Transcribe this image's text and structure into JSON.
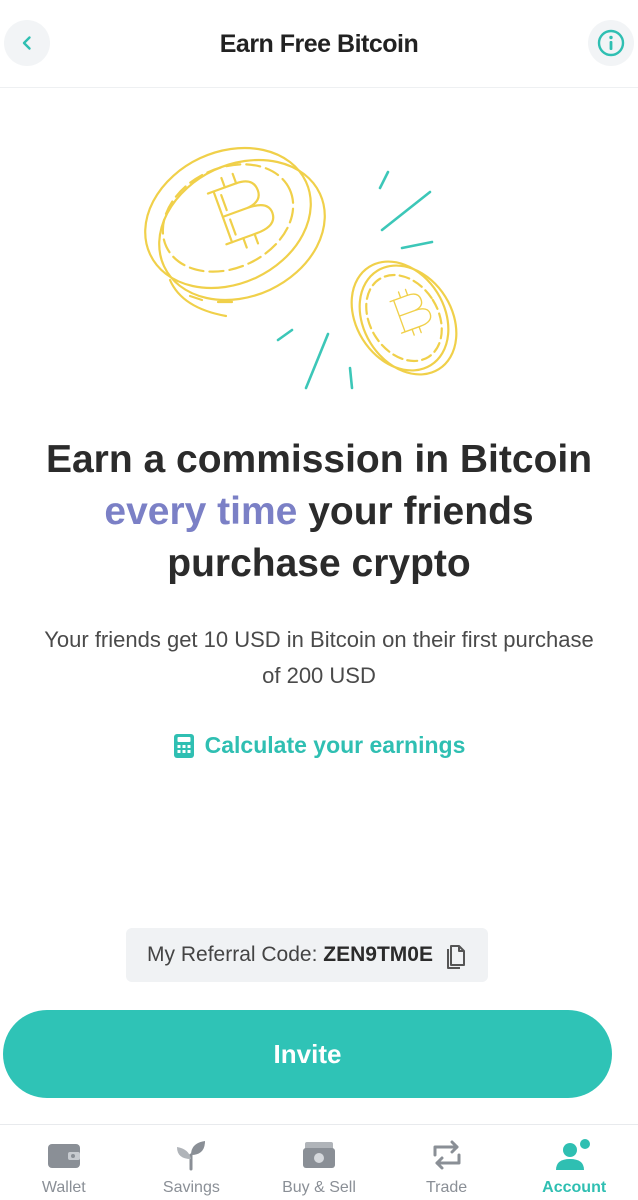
{
  "header": {
    "title": "Earn Free Bitcoin",
    "back_icon": "chevron-left-icon",
    "info_icon": "info-icon"
  },
  "illustration": {
    "icon": "bitcoin-coins-icon",
    "coin_color": "#f0d04a",
    "spark_color": "#3cc7b8"
  },
  "headline": {
    "part1": "Earn a commission in Bitcoin ",
    "accent": "every time",
    "part2": " your friends purchase crypto",
    "accent_color": "#7b80c6"
  },
  "subtext": "Your friends get 10 USD in Bitcoin on their first purchase of 200 USD",
  "calculate": {
    "label": "Calculate your earnings",
    "icon": "calculator-icon"
  },
  "referral": {
    "label": "My Referral Code: ",
    "code": "ZEN9TM0E",
    "icon": "copy-icon"
  },
  "invite": {
    "label": "Invite"
  },
  "tabs": [
    {
      "label": "Wallet",
      "icon": "wallet-icon",
      "active": false
    },
    {
      "label": "Savings",
      "icon": "sprout-icon",
      "active": false
    },
    {
      "label": "Buy & Sell",
      "icon": "cash-icon",
      "active": false
    },
    {
      "label": "Trade",
      "icon": "swap-icon",
      "active": false
    },
    {
      "label": "Account",
      "icon": "user-group-icon",
      "active": true
    }
  ],
  "colors": {
    "brand": "#2fc3b6",
    "accent": "#7b80c6",
    "tab_inactive": "#8a8f96"
  }
}
